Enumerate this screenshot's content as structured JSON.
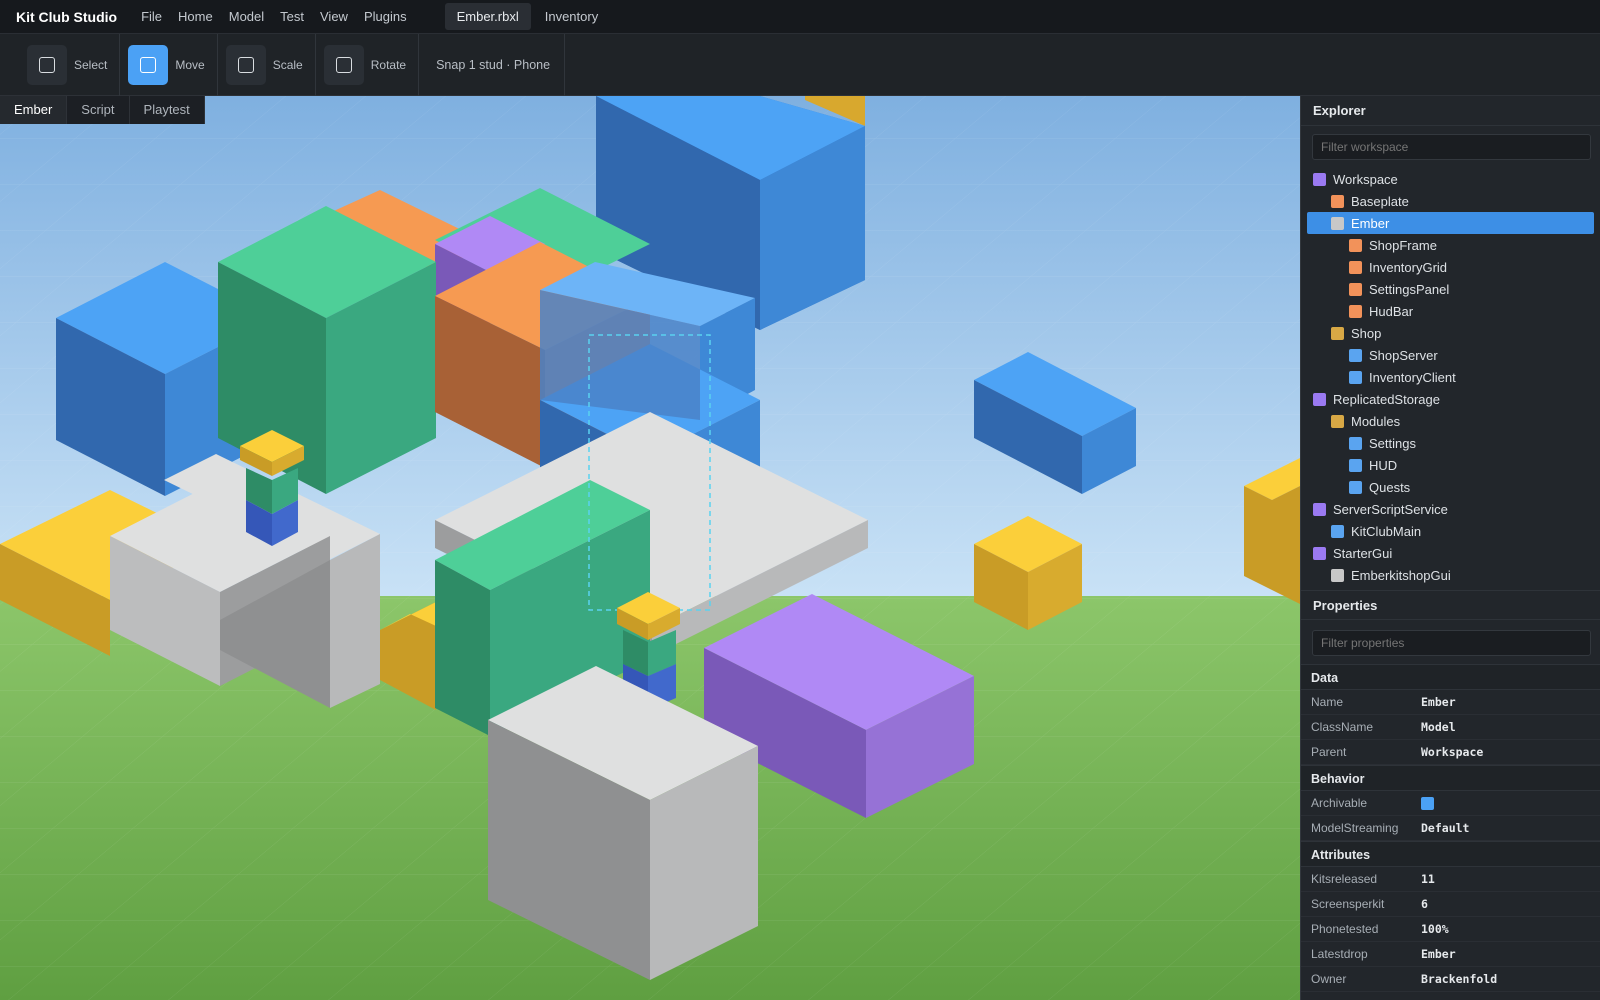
{
  "app": {
    "title": "Kit Club Studio"
  },
  "menu": [
    "File",
    "Home",
    "Model",
    "Test",
    "View",
    "Plugins"
  ],
  "doc_tabs": [
    "Ember.rbxl",
    "Inventory"
  ],
  "toolbar": {
    "tools": [
      {
        "label": "Select",
        "active": false
      },
      {
        "label": "Move",
        "active": true
      },
      {
        "label": "Scale",
        "active": false
      },
      {
        "label": "Rotate",
        "active": false
      }
    ],
    "snap": "Snap 1 stud · Phone"
  },
  "viewport_tabs": [
    {
      "label": "Ember",
      "active": true
    },
    {
      "label": "Script",
      "active": false
    },
    {
      "label": "Playtest",
      "active": false
    }
  ],
  "explorer": {
    "title": "Explorer",
    "filter_placeholder": "Filter workspace",
    "items": [
      {
        "label": "Workspace",
        "depth": 0,
        "color": "#9b7af2"
      },
      {
        "label": "Baseplate",
        "depth": 1,
        "color": "#f2925a"
      },
      {
        "label": "Ember",
        "depth": 1,
        "color": "#c8c8c8",
        "selected": true
      },
      {
        "label": "ShopFrame",
        "depth": 2,
        "color": "#f2925a"
      },
      {
        "label": "InventoryGrid",
        "depth": 2,
        "color": "#f2925a"
      },
      {
        "label": "SettingsPanel",
        "depth": 2,
        "color": "#f2925a"
      },
      {
        "label": "HudBar",
        "depth": 2,
        "color": "#f2925a"
      },
      {
        "label": "Shop",
        "depth": 1,
        "color": "#d8a845"
      },
      {
        "label": "ShopServer",
        "depth": 2,
        "color": "#5aa4f0"
      },
      {
        "label": "InventoryClient",
        "depth": 2,
        "color": "#5aa4f0"
      },
      {
        "label": "ReplicatedStorage",
        "depth": 0,
        "color": "#9b7af2"
      },
      {
        "label": "Modules",
        "depth": 1,
        "color": "#d8a845"
      },
      {
        "label": "Settings",
        "depth": 2,
        "color": "#5aa4f0"
      },
      {
        "label": "HUD",
        "depth": 2,
        "color": "#5aa4f0"
      },
      {
        "label": "Quests",
        "depth": 2,
        "color": "#5aa4f0"
      },
      {
        "label": "ServerScriptService",
        "depth": 0,
        "color": "#9b7af2"
      },
      {
        "label": "KitClubMain",
        "depth": 1,
        "color": "#5aa4f0"
      },
      {
        "label": "StarterGui",
        "depth": 0,
        "color": "#9b7af2"
      },
      {
        "label": "EmberkitshopGui",
        "depth": 1,
        "color": "#c8c8c8"
      }
    ]
  },
  "properties": {
    "title": "Properties",
    "filter_placeholder": "Filter properties",
    "groups": [
      {
        "name": "Data",
        "rows": [
          {
            "key": "Name",
            "value": "Ember"
          },
          {
            "key": "ClassName",
            "value": "Model"
          },
          {
            "key": "Parent",
            "value": "Workspace"
          }
        ]
      },
      {
        "name": "Behavior",
        "rows": [
          {
            "key": "Archivable",
            "value": "",
            "checkbox": true
          },
          {
            "key": "ModelStreaming",
            "value": "Default"
          }
        ]
      },
      {
        "name": "Attributes",
        "rows": [
          {
            "key": "Kitsreleased",
            "value": "11"
          },
          {
            "key": "Screensperkit",
            "value": "6"
          },
          {
            "key": "Phonetested",
            "value": "100%"
          },
          {
            "key": "Latestdrop",
            "value": "Ember"
          },
          {
            "key": "Owner",
            "value": "Brackenfold"
          }
        ]
      }
    ]
  },
  "colors": {
    "accent": "#4ba1f5",
    "selection": "#3d8fe6",
    "sky": "#a9cdef",
    "ground": "#6dae4e"
  }
}
